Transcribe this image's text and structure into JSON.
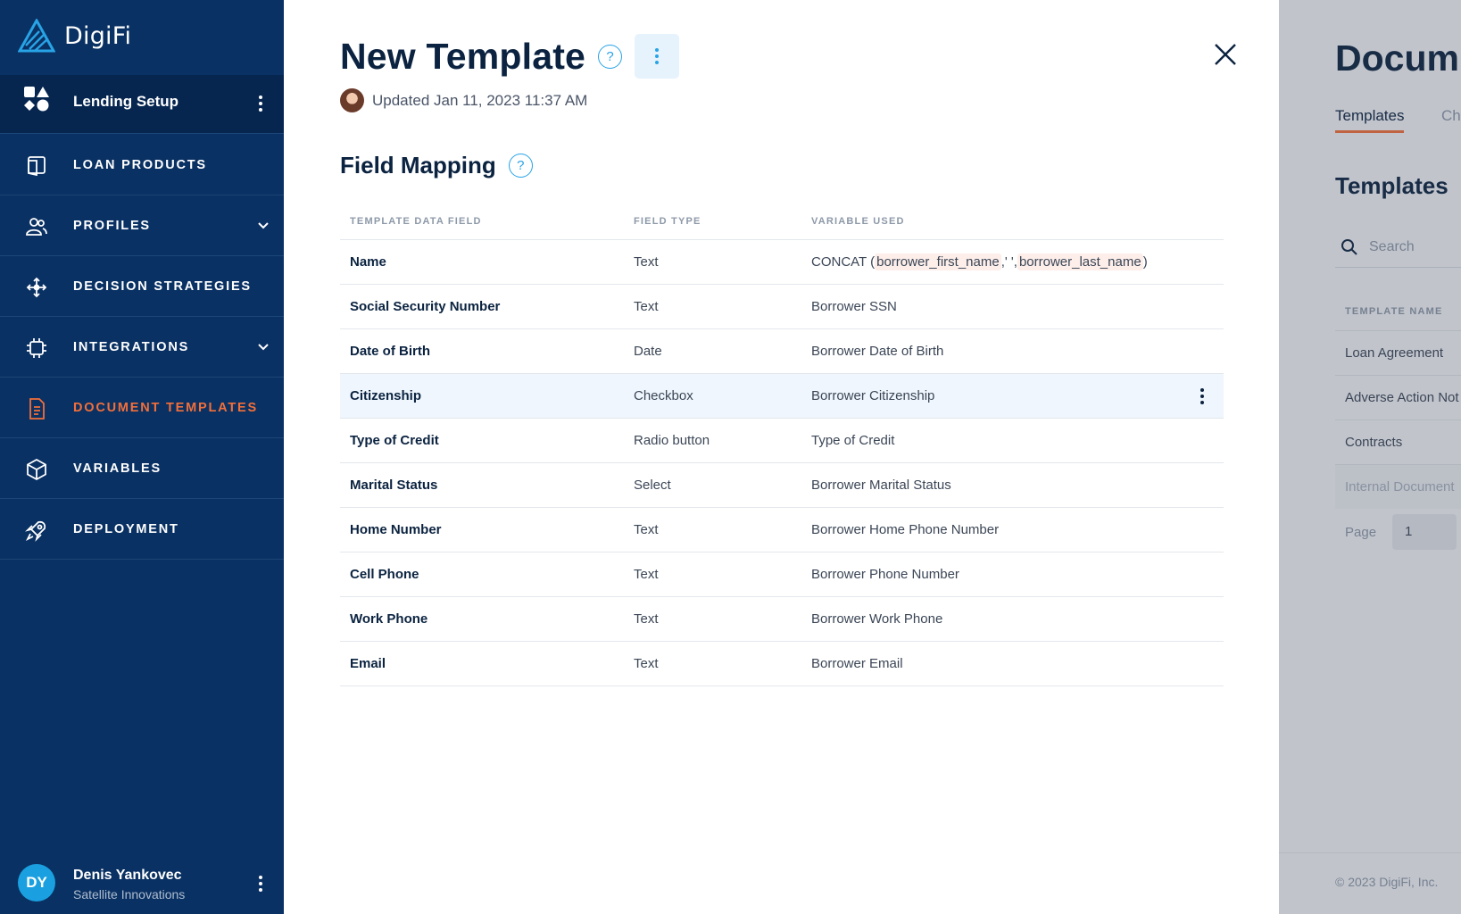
{
  "sidebar": {
    "brand": "DigiFi",
    "setup_label": "Lending Setup",
    "active_color": "#f26f3a",
    "items": [
      {
        "label": "LOAN PRODUCTS",
        "icon": "book-icon"
      },
      {
        "label": "PROFILES",
        "icon": "users-icon",
        "expandable": true
      },
      {
        "label": "DECISION STRATEGIES",
        "icon": "move-arrows-icon"
      },
      {
        "label": "INTEGRATIONS",
        "icon": "chip-icon",
        "expandable": true
      },
      {
        "label": "DOCUMENT TEMPLATES",
        "icon": "document-icon",
        "active": true
      },
      {
        "label": "VARIABLES",
        "icon": "cube-icon"
      },
      {
        "label": "DEPLOYMENT",
        "icon": "rocket-icon"
      }
    ],
    "user": {
      "initials": "DY",
      "name": "Denis Yankovec",
      "company": "Satellite Innovations"
    }
  },
  "panel": {
    "title": "New Template",
    "help_glyph": "?",
    "updated": "Updated Jan 11, 2023 11:37 AM",
    "section_title": "Field Mapping",
    "columns": [
      "TEMPLATE DATA FIELD",
      "FIELD TYPE",
      "VARIABLE USED"
    ],
    "concat": {
      "func": "CONCAT",
      "open": "(",
      "arg1": "borrower_first_name",
      "sep": ",",
      "arg2": "' '",
      "sep2": ",",
      "arg3": "borrower_last_name",
      "close": ")"
    },
    "rows": [
      {
        "field": "Name",
        "type": "Text",
        "variable": ""
      },
      {
        "field": "Social Security Number",
        "type": "Text",
        "variable": "Borrower SSN"
      },
      {
        "field": "Date of Birth",
        "type": "Date",
        "variable": "Borrower Date of Birth"
      },
      {
        "field": "Citizenship",
        "type": "Checkbox",
        "variable": "Borrower Citizenship"
      },
      {
        "field": "Type of Credit",
        "type": "Radio button",
        "variable": "Type of Credit"
      },
      {
        "field": "Marital Status",
        "type": "Select",
        "variable": "Borrower Marital Status"
      },
      {
        "field": "Home Number",
        "type": "Text",
        "variable": "Borrower Home Phone Number"
      },
      {
        "field": "Cell Phone",
        "type": "Text",
        "variable": "Borrower Phone Number"
      },
      {
        "field": "Work Phone",
        "type": "Text",
        "variable": "Borrower Work Phone"
      },
      {
        "field": "Email",
        "type": "Text",
        "variable": "Borrower Email"
      }
    ]
  },
  "background": {
    "title": "Docum",
    "tabs": [
      "Templates",
      "Ch"
    ],
    "subtitle": "Templates",
    "search_placeholder": "Search",
    "column": "TEMPLATE NAME",
    "rows": [
      "Loan Agreement",
      "Adverse Action Not",
      "Contracts",
      "Internal Document"
    ],
    "page_label": "Page",
    "page_value": "1",
    "footer": "© 2023 DigiFi, Inc."
  },
  "colors": {
    "sidebar": "#0a3163",
    "accent": "#f26f3a",
    "link": "#27a3e6",
    "highlight_row": "#eff6fd"
  }
}
